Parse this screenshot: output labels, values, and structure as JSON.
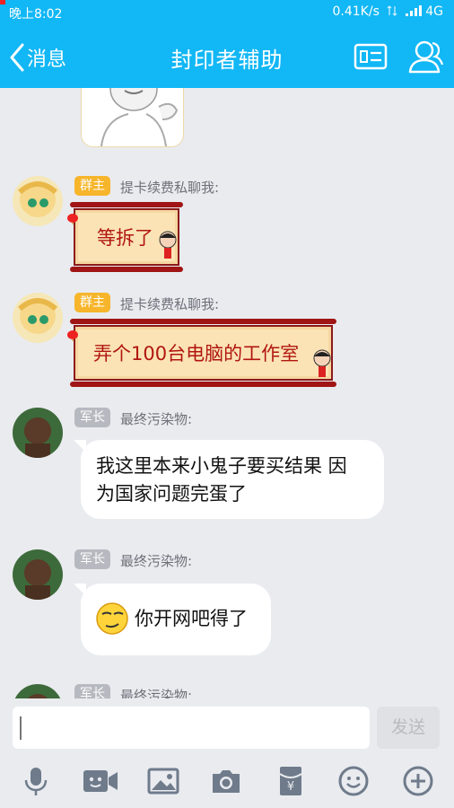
{
  "status_bar": {
    "time": "晚上8:02",
    "network": "0.41K/s",
    "signal": "4G"
  },
  "header": {
    "back_label": "消息",
    "title": "封印者辅助"
  },
  "messages": [
    {
      "badge": "群主",
      "sender": "提卡续费私聊我:",
      "text": "等拆了"
    },
    {
      "badge": "群主",
      "sender": "提卡续费私聊我:",
      "text": "弄个100台电脑的工作室"
    },
    {
      "badge": "军长",
      "sender": "最终污染物:",
      "line1": "我这里本来小鬼子要买结果 因",
      "line2": "为国家问题完蛋了"
    },
    {
      "badge": "军长",
      "sender": "最终污染物:",
      "text": "你开网吧得了"
    },
    {
      "badge": "军长",
      "sender": "最终污染物:"
    }
  ],
  "input": {
    "send_label": "发送"
  },
  "colors": {
    "header": "#12b7f5",
    "background": "#e9ebef",
    "owner_badge": "#f7b52b",
    "rank_badge": "#b6b9bf"
  },
  "toolbar_icons": [
    "microphone-icon",
    "video-icon",
    "image-icon",
    "camera-icon",
    "red-packet-icon",
    "emoji-icon",
    "plus-icon"
  ]
}
